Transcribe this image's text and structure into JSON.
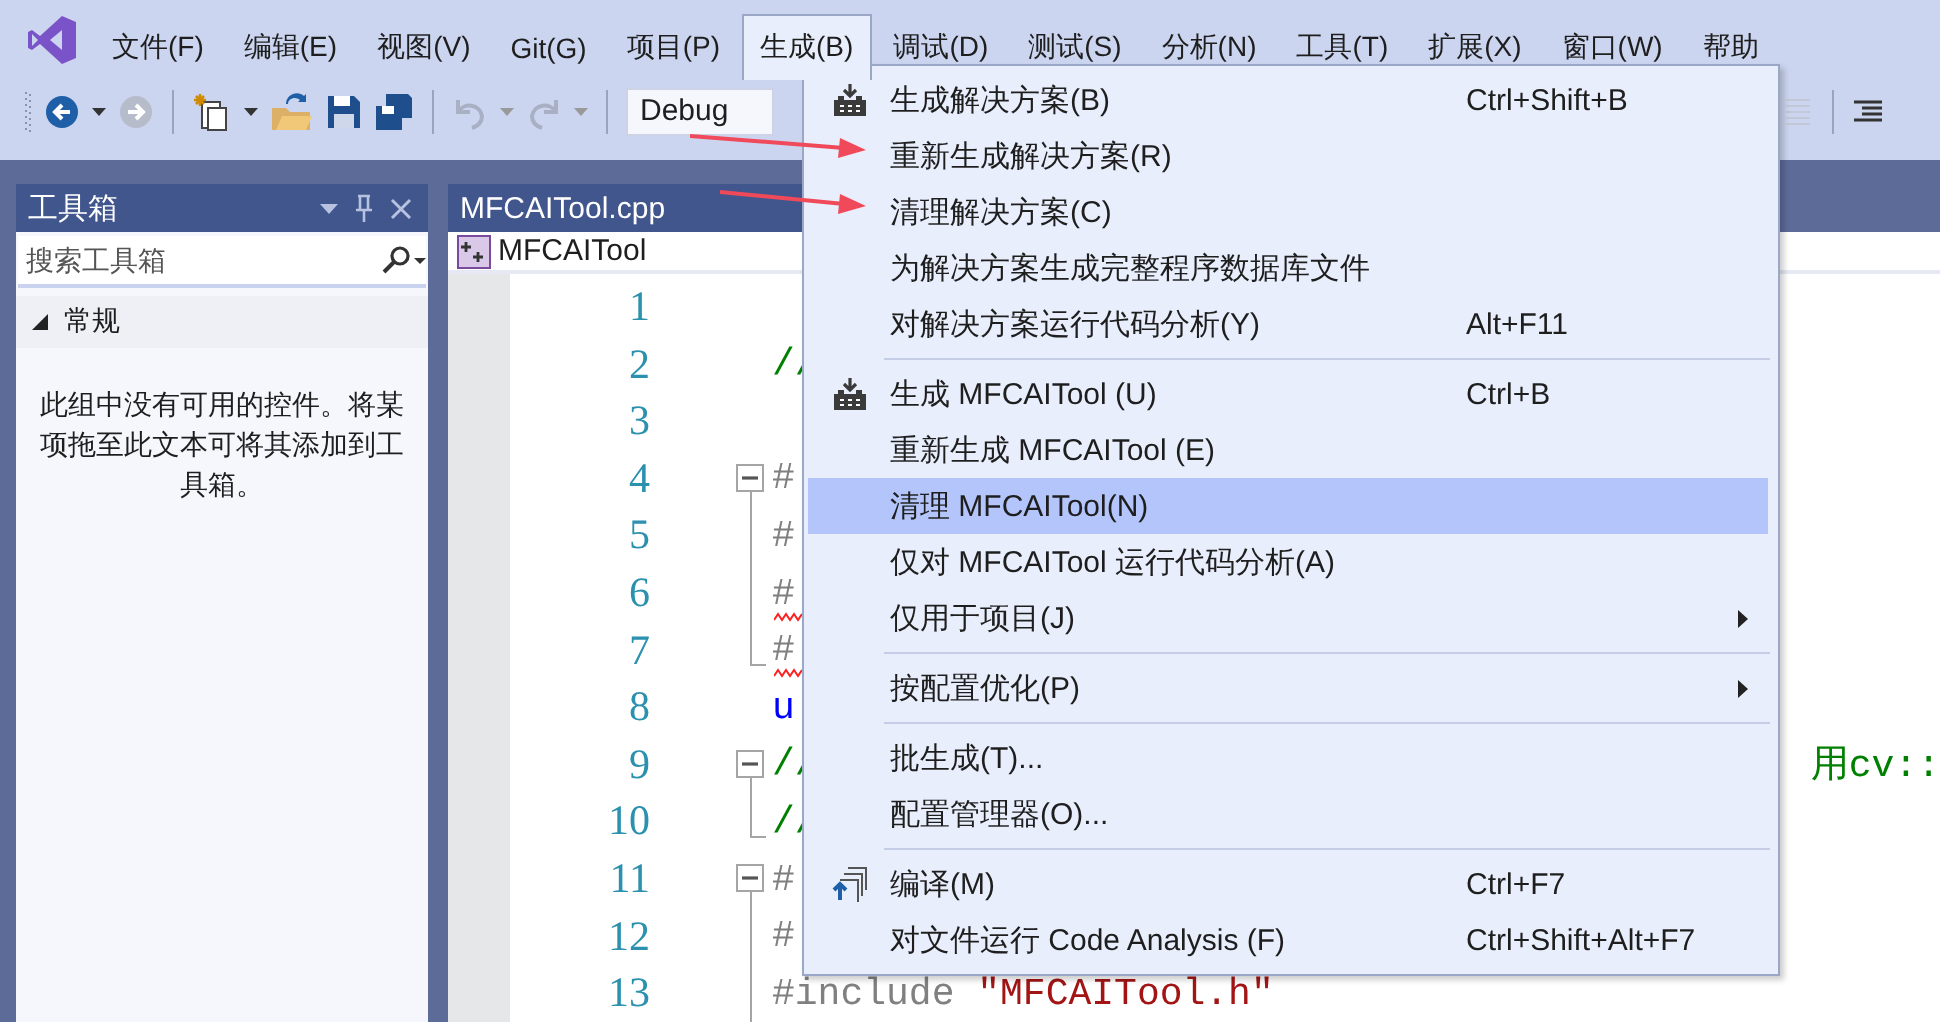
{
  "menubar": {
    "items": [
      {
        "label": "文件(F)",
        "selected": false
      },
      {
        "label": "编辑(E)",
        "selected": false
      },
      {
        "label": "视图(V)",
        "selected": false
      },
      {
        "label": "Git(G)",
        "selected": false
      },
      {
        "label": "项目(P)",
        "selected": false
      },
      {
        "label": "生成(B)",
        "selected": true
      },
      {
        "label": "调试(D)",
        "selected": false
      },
      {
        "label": "测试(S)",
        "selected": false
      },
      {
        "label": "分析(N)",
        "selected": false
      },
      {
        "label": "工具(T)",
        "selected": false
      },
      {
        "label": "扩展(X)",
        "selected": false
      },
      {
        "label": "窗口(W)",
        "selected": false
      },
      {
        "label": "帮助",
        "selected": false
      }
    ]
  },
  "toolbar": {
    "configuration": "Debug"
  },
  "toolbox": {
    "title": "工具箱",
    "search": {
      "placeholder": "搜索工具箱"
    },
    "group": {
      "label": "常规",
      "expanded": true
    },
    "message": "此组中没有可用的控件。将某项拖至此文本可将其添加到工具箱。"
  },
  "editor": {
    "tab": "MFCAITool.cpp",
    "scope": "MFCAITool",
    "lines": [
      {
        "number": "1"
      },
      {
        "number": "2",
        "segments": [
          {
            "kind": "comment",
            "text": "//"
          }
        ]
      },
      {
        "number": "3"
      },
      {
        "number": "4",
        "expanded": true,
        "segments": [
          {
            "kind": "preprocessor",
            "text": "#"
          }
        ],
        "children": [
          {
            "number": "5",
            "segments": [
              {
                "kind": "preprocessor",
                "text": "#"
              }
            ]
          },
          {
            "number": "6",
            "squiggle": true,
            "segments": [
              {
                "kind": "preprocessor",
                "text": "#"
              }
            ]
          },
          {
            "number": "7",
            "squiggle": true,
            "segments": [
              {
                "kind": "preprocessor",
                "text": "#"
              }
            ]
          }
        ]
      },
      {
        "number": "8",
        "segments": [
          {
            "kind": "keyword",
            "text": "u"
          }
        ]
      },
      {
        "number": "9",
        "expanded": true,
        "segments": [
          {
            "kind": "comment",
            "text": "//"
          }
        ],
        "tail": "用cv::",
        "children": [
          {
            "number": "10",
            "segments": [
              {
                "kind": "comment",
                "text": "//"
              }
            ]
          }
        ]
      },
      {
        "number": "11",
        "expanded": true,
        "segments": [
          {
            "kind": "preprocessor",
            "text": "#"
          }
        ],
        "children": [
          {
            "number": "12",
            "segments": [
              {
                "kind": "preprocessor",
                "text": "#"
              }
            ]
          },
          {
            "number": "13",
            "segments": [
              {
                "kind": "preprocessor",
                "text": "#include "
              },
              {
                "kind": "string",
                "text": "\"MFCAITool.h\""
              }
            ]
          }
        ]
      }
    ]
  },
  "build_menu": {
    "items": [
      {
        "kind": "build",
        "label": "生成解决方案(B)",
        "shortcut": "Ctrl+Shift+B",
        "selected": false
      },
      {
        "kind": "item",
        "label": "重新生成解决方案(R)",
        "selected": false
      },
      {
        "kind": "item",
        "label": "清理解决方案(C)",
        "selected": false
      },
      {
        "kind": "item",
        "label": "为解决方案生成完整程序数据库文件",
        "selected": false
      },
      {
        "kind": "item",
        "label": "对解决方案运行代码分析(Y)",
        "shortcut": "Alt+F11",
        "selected": false
      },
      {
        "kind": "separator"
      },
      {
        "kind": "build",
        "label": "生成 MFCAITool (U)",
        "shortcut": "Ctrl+B",
        "selected": false
      },
      {
        "kind": "item",
        "label": "重新生成 MFCAITool (E)",
        "selected": false
      },
      {
        "kind": "item",
        "label": "清理 MFCAITool(N)",
        "selected": true
      },
      {
        "kind": "item",
        "label": "仅对 MFCAITool 运行代码分析(A)",
        "selected": false
      },
      {
        "kind": "item",
        "label": "仅用于项目(J)",
        "submenu": true,
        "selected": false
      },
      {
        "kind": "separator"
      },
      {
        "kind": "item",
        "label": "按配置优化(P)",
        "submenu": true,
        "selected": false
      },
      {
        "kind": "separator"
      },
      {
        "kind": "item",
        "label": "批生成(T)...",
        "selected": false
      },
      {
        "kind": "item",
        "label": "配置管理器(O)...",
        "selected": false
      },
      {
        "kind": "separator"
      },
      {
        "kind": "compile",
        "label": "编译(M)",
        "shortcut": "Ctrl+F7",
        "selected": false
      },
      {
        "kind": "item",
        "label": "对文件运行 Code Analysis (F)",
        "shortcut": "Ctrl+Shift+Alt+F7",
        "selected": false
      }
    ]
  },
  "annotations": [
    {
      "kind": "arrow"
    },
    {
      "kind": "arrow"
    }
  ]
}
